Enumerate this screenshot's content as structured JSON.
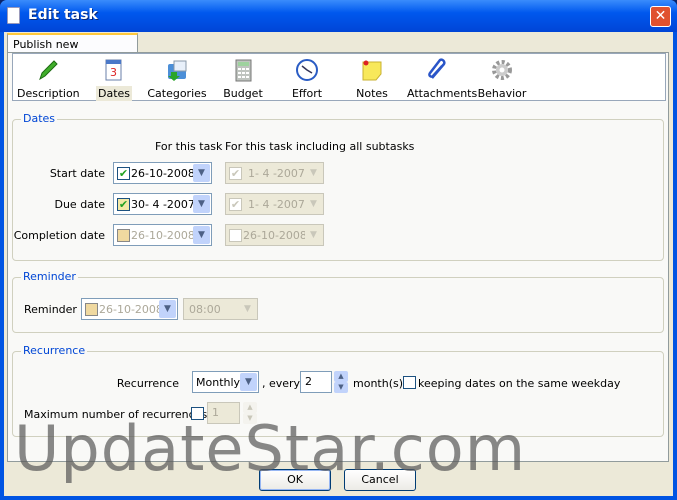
{
  "window": {
    "title": "Edit task",
    "close": "✕"
  },
  "tab": "Publish new screenshots",
  "toolbar": [
    {
      "label": "Description",
      "icon": "pencil-icon"
    },
    {
      "label": "Dates",
      "icon": "calendar-icon"
    },
    {
      "label": "Categories",
      "icon": "folder-icon"
    },
    {
      "label": "Budget",
      "icon": "calculator-icon"
    },
    {
      "label": "Effort",
      "icon": "clock-icon"
    },
    {
      "label": "Notes",
      "icon": "note-icon"
    },
    {
      "label": "Attachments",
      "icon": "paperclip-icon"
    },
    {
      "label": "Behavior",
      "icon": "gear-icon"
    }
  ],
  "dates": {
    "legend": "Dates",
    "col1": "For this task",
    "col2": "For this task including all subtasks",
    "rows": [
      {
        "label": "Start date",
        "own": "26-10-2008",
        "own_checked": true,
        "sub": "1- 4 -2007",
        "sub_checked": true
      },
      {
        "label": "Due date",
        "own": "30- 4 -2007",
        "own_checked": true,
        "sub": "1- 4 -2007",
        "sub_checked": true
      },
      {
        "label": "Completion date",
        "own": "26-10-2008",
        "own_checked": false,
        "sub": "26-10-2008",
        "sub_checked": false
      }
    ]
  },
  "reminder": {
    "legend": "Reminder",
    "label": "Reminder",
    "date": "26-10-2008",
    "time": "08:00"
  },
  "recurrence": {
    "legend": "Recurrence",
    "label": "Recurrence",
    "period": "Monthly",
    "every": ", every",
    "amount": "2",
    "unit": "month(s),",
    "weekday": "keeping dates on the same weekday",
    "max_label": "Maximum number of recurrences",
    "max_value": "1"
  },
  "buttons": {
    "ok": "OK",
    "cancel": "Cancel"
  },
  "watermark": "UpdateStar.com"
}
